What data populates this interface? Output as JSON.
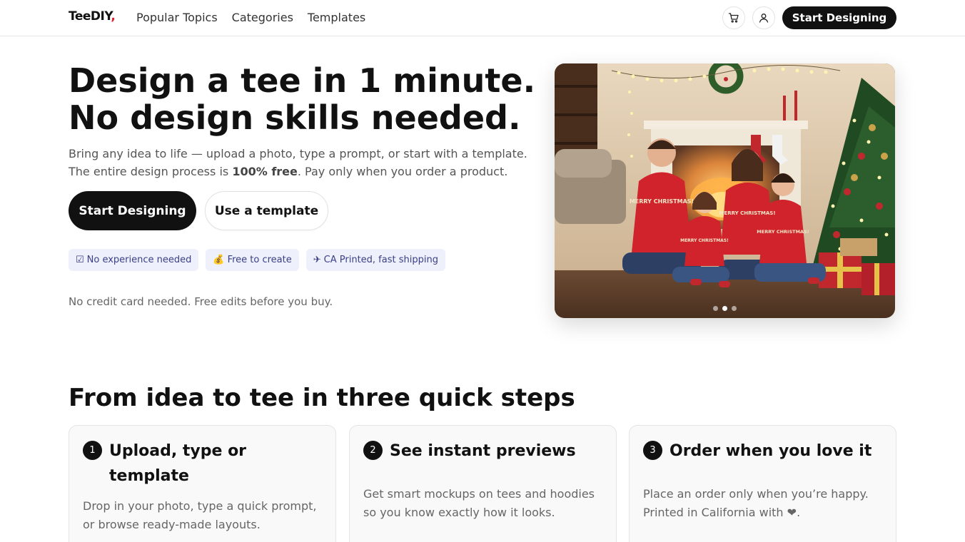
{
  "header": {
    "logo": "TeeDIY",
    "logo_mark": ",",
    "nav": [
      "Popular Topics",
      "Categories",
      "Templates"
    ],
    "cart_icon": "cart-icon",
    "user_icon": "user-icon",
    "cta": "Start Designing"
  },
  "hero": {
    "title_line1": "Design a tee in 1 minute.",
    "title_line2": "No design skills needed.",
    "sub_line1": "Bring any idea to life — upload a photo, type a prompt, or start with a template.",
    "sub_line2_pre": "The entire design process is ",
    "sub_line2_bold": "100% free",
    "sub_line2_post": ". Pay only when you order a product.",
    "primary_button": "Start Designing",
    "secondary_button": "Use a template",
    "chips": [
      {
        "icon": "☑",
        "label": "No experience needed"
      },
      {
        "icon": "💰",
        "label": "Free to create"
      },
      {
        "icon": "✈",
        "label": "CA Printed, fast shipping"
      }
    ],
    "note": "No credit card needed. Free edits before you buy.",
    "carousel": {
      "slides": 3,
      "active": 2
    },
    "sweater_text": "MERRY CHRISTMAS!"
  },
  "steps": {
    "title": "From idea to tee in three quick steps",
    "items": [
      {
        "num": "1",
        "title_line1": "Upload, type or",
        "title_line2": "template",
        "body_line1": "Drop in your photo, type a quick prompt,",
        "body_line2": "or browse ready-made layouts."
      },
      {
        "num": "2",
        "title_line1": "See instant previews",
        "title_line2": "",
        "body_line1": "Get smart mockups on tees and hoodies",
        "body_line2": "so you know exactly how it looks."
      },
      {
        "num": "3",
        "title_line1": "Order when you love it",
        "title_line2": "",
        "body_line1": "Place an order only when you’re happy.",
        "body_line2": "Printed in California with ❤."
      }
    ]
  },
  "colors": {
    "primary": "#111111",
    "chip_bg": "#eef0fb",
    "chip_text": "#3b3f86",
    "logo_accent": "#e11d2e",
    "sweater": "#d0232b"
  }
}
